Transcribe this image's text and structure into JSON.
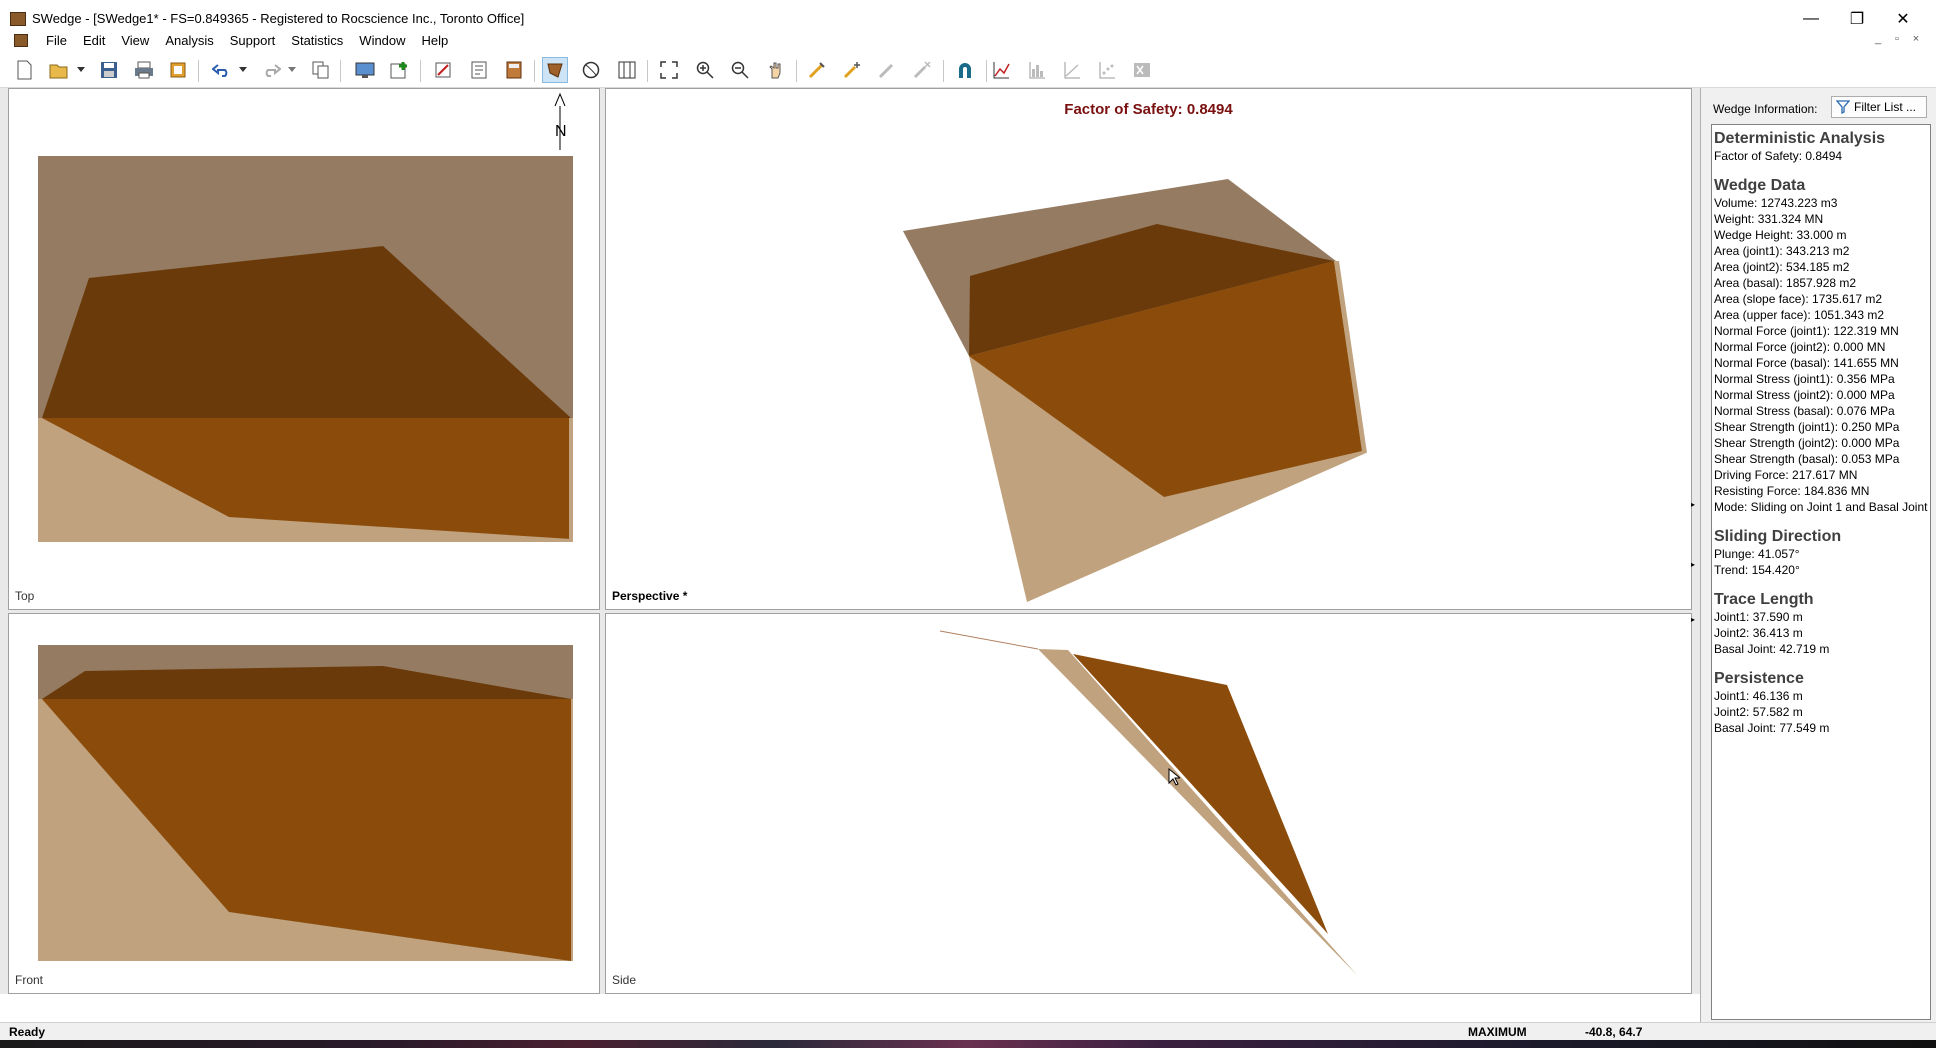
{
  "window": {
    "title": "SWedge - [SWedge1* - FS=0.849365 - Registered to Rocscience Inc., Toronto Office]",
    "controls": [
      "—",
      "❐",
      "✕"
    ]
  },
  "menu": {
    "items": [
      "File",
      "Edit",
      "View",
      "Analysis",
      "Support",
      "Statistics",
      "Window",
      "Help"
    ],
    "mdi_controls": [
      "_",
      "▫",
      "×"
    ]
  },
  "toolbar": {
    "buttons": [
      "new-icon",
      "open-icon",
      "dropdown-icon",
      "save-icon",
      "print-icon",
      "export-icon",
      "undo-icon",
      "redo-icon",
      "copy-icon",
      "render-icon",
      "add-icon",
      "edit-icon",
      "report-icon",
      "calculator-icon",
      "wedge-view-icon",
      "stereonet-icon",
      "split-view-icon",
      "zoom-all-icon",
      "zoom-in-icon",
      "zoom-out-icon",
      "pan-icon",
      "bolt-icon",
      "bolt-add-icon",
      "bolt-edit-icon",
      "bolt-delete-icon",
      "magnet-icon",
      "graph-icon",
      "histogram-icon",
      "line-graph-icon",
      "scatter-icon",
      "excel-icon"
    ]
  },
  "views": {
    "top": {
      "label": "Top"
    },
    "perspective": {
      "label": "Perspective *",
      "title": "Factor of Safety: 0.8494"
    },
    "front": {
      "label": "Front"
    },
    "side": {
      "label": "Side"
    },
    "north_label": "N"
  },
  "info_panel": {
    "header_label": "Wedge Information:",
    "filter_button": "Filter List ...",
    "sections": [
      {
        "heading": "Deterministic Analysis",
        "rows": [
          "Factor of Safety: 0.8494"
        ]
      },
      {
        "heading": "Wedge Data",
        "rows": [
          "Volume: 12743.223 m3",
          "Weight: 331.324 MN",
          "Wedge Height: 33.000 m",
          "Area (joint1): 343.213 m2",
          "Area (joint2): 534.185 m2",
          "Area (basal): 1857.928 m2",
          "Area (slope face): 1735.617 m2",
          "Area (upper face): 1051.343 m2",
          "Normal Force (joint1): 122.319 MN",
          "Normal Force (joint2): 0.000 MN",
          "Normal Force (basal): 141.655 MN",
          "Normal Stress (joint1): 0.356 MPa",
          "Normal Stress (joint2): 0.000 MPa",
          "Normal Stress (basal): 0.076 MPa",
          "Shear Strength (joint1): 0.250 MPa",
          "Shear Strength (joint2): 0.000 MPa",
          "Shear Strength (basal): 0.053 MPa",
          "Driving Force: 217.617 MN",
          "Resisting Force: 184.836 MN",
          "Mode: Sliding on Joint 1 and Basal Joint"
        ]
      },
      {
        "heading": "Sliding Direction",
        "rows": [
          "Plunge: 41.057°",
          "Trend: 154.420°"
        ]
      },
      {
        "heading": "Trace Length",
        "rows": [
          "Joint1: 37.590 m",
          "Joint2: 36.413 m",
          "Basal Joint: 42.719 m"
        ]
      },
      {
        "heading": "Persistence",
        "rows": [
          "Joint1: 46.136 m",
          "Joint2: 57.582 m",
          "Basal Joint: 77.549 m"
        ]
      }
    ]
  },
  "status": {
    "left": "Ready",
    "mode": "MAXIMUM",
    "coords": "-40.8, 64.7"
  },
  "colors": {
    "wedge_dark": "#6b3a0a",
    "wedge_face": "#8b4c0b",
    "slope_upper": "#947b61",
    "slope_lower": "#c0a27e",
    "fos_title": "#7a1010"
  }
}
